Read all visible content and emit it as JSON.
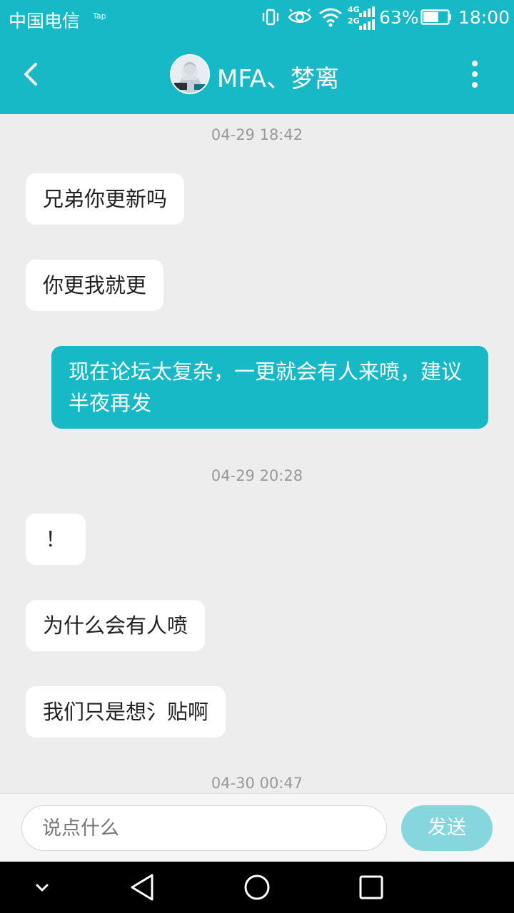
{
  "status_bar": {
    "carrier": "中国电信",
    "carrier_badge": "Tap",
    "network_top": "4G",
    "network_bottom": "2G",
    "battery_percent": "63%",
    "battery_level": 0.63,
    "time": "18:00"
  },
  "header": {
    "title": "MFA、梦离",
    "back_icon": "chevron-left-icon",
    "more_icon": "more-vertical-icon"
  },
  "messages": [
    {
      "kind": "timestamp",
      "text": "04-29 18:42"
    },
    {
      "kind": "incoming",
      "text": "兄弟你更新吗"
    },
    {
      "kind": "incoming",
      "text": "你更我就更"
    },
    {
      "kind": "outgoing",
      "text": "现在论坛太复杂，一更就会有人来喷，建议半夜再发"
    },
    {
      "kind": "timestamp",
      "text": "04-29 20:28"
    },
    {
      "kind": "incoming",
      "text": "！"
    },
    {
      "kind": "incoming",
      "text": "为什么会有人喷"
    },
    {
      "kind": "incoming",
      "text": "我们只是想氵贴啊"
    },
    {
      "kind": "timestamp",
      "text": "04-30 00:47"
    }
  ],
  "composer": {
    "placeholder": "说点什么",
    "send_label": "发送"
  },
  "colors": {
    "accent": "#17b9c6",
    "background": "#ededed",
    "send_disabled": "#86d6dd"
  },
  "nav_icons": [
    "chevron-down-icon",
    "back-triangle-icon",
    "home-circle-icon",
    "recents-square-icon"
  ]
}
